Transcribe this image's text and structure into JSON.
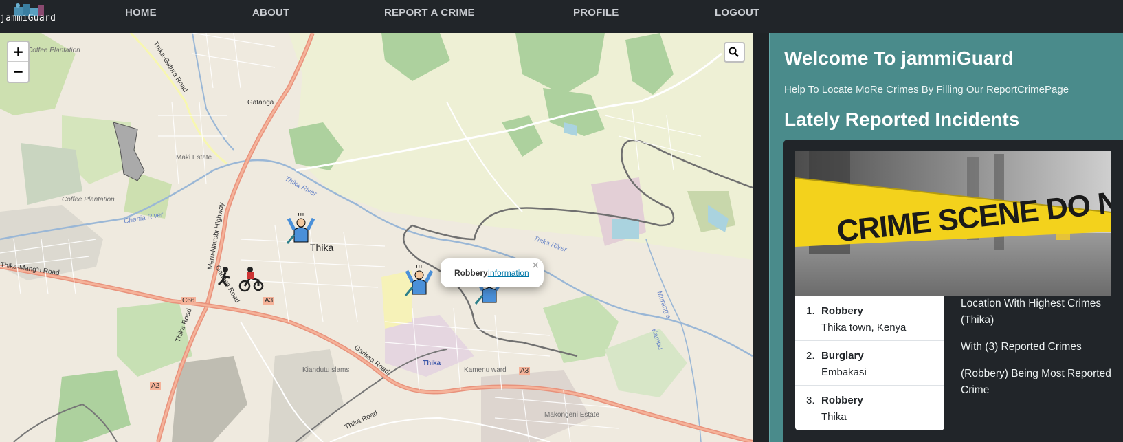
{
  "app": {
    "logo_text": "jammiGuard"
  },
  "nav": {
    "items": [
      {
        "label": "HOME"
      },
      {
        "label": "ABOUT"
      },
      {
        "label": "REPORT A CRIME"
      },
      {
        "label": "PROFILE"
      },
      {
        "label": "LOGOUT"
      }
    ]
  },
  "map": {
    "zoom_in": "+",
    "zoom_out": "−",
    "search_icon": "magnifier-icon",
    "popup": {
      "title": "Robbery",
      "link": "Information",
      "close": "×"
    },
    "labels": [
      "Coffee Plantation",
      "Coffee Plantation",
      "Maki Estate",
      "Thika",
      "Thika River",
      "Thika River",
      "Chania River",
      "Thika-Mang'u Road",
      "Thika-Gatura Road",
      "Meru-Nairobi Highway",
      "Garissa Road",
      "Garissa Road",
      "Thika Road",
      "Kiandutu slams",
      "Kamenu ward",
      "Makongeni Estate",
      "Gatanga",
      "Murang'a",
      "Kambu",
      "Thika",
      "Thika Road",
      "A3",
      "A3",
      "C66",
      "A2"
    ],
    "markers": [
      "robbery-marker",
      "robbery-marker",
      "robbery-marker",
      "burglary-marker"
    ]
  },
  "panel": {
    "welcome": "Welcome To jammiGuard",
    "help": "Help To Locate MoRe Crimes By Filling Our ReportCrimePage",
    "lately": "Lately Reported Incidents",
    "image_alt": "CRIME SCENE DO NOT CROSS",
    "incidents": [
      {
        "num": "1.",
        "type": "Robbery",
        "location": "Thika town, Kenya"
      },
      {
        "num": "2.",
        "type": "Burglary",
        "location": "Embakasi"
      },
      {
        "num": "3.",
        "type": "Robbery",
        "location": "Thika"
      }
    ],
    "stats": {
      "highest": "Location With Highest Crimes (Thika)",
      "count": "With (3) Reported Crimes",
      "most": "(Robbery) Being Most Reported Crime"
    }
  },
  "colors": {
    "navbar": "#212529",
    "panel": "#4a8b8b",
    "map_bg": "#efeadf",
    "road_primary": "#e8927c",
    "river": "#aad3df",
    "forest": "#add19e"
  }
}
